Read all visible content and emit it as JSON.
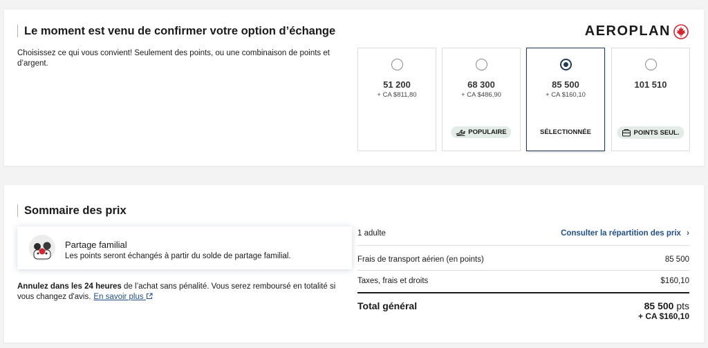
{
  "exchange": {
    "title": "Le moment est venu de confirmer votre option d’échange",
    "logo": "AEROPLAN",
    "intro": "Choisissez ce qui vous convient! Seulement des points, ou une combinaison de points et d’argent.",
    "options": [
      {
        "points": "51 200",
        "cash": "+ CA $811,80",
        "badge": "",
        "selected": false
      },
      {
        "points": "68 300",
        "cash": "+ CA $486,90",
        "badge": "POPULAIRE",
        "badge_icon": "plane-icon",
        "selected": false
      },
      {
        "points": "85 500",
        "cash": "+ CA $160,10",
        "badge": "SÉLECTIONNÉE",
        "selected": true
      },
      {
        "points": "101 510",
        "cash": "",
        "badge": "POINTS SEUL.",
        "badge_icon": "ticket-icon",
        "selected": false
      }
    ]
  },
  "summary": {
    "title": "Sommaire des prix",
    "family_title": "Partage familial",
    "family_text": "Les points seront échangés à partir du solde de partage familial.",
    "cancel_bold": "Annulez dans les 24 heures",
    "cancel_text": " de l’achat sans pénalité. Vous serez remboursé en totalité si vous changez d'avis.",
    "learn_more": "En savoir plus",
    "passengers": "1 adulte",
    "breakdown_link": "Consulter la répartition des prix",
    "fare_label": "Frais de transport aérien (en points)",
    "fare_value": "85 500",
    "taxes_label": "Taxes, frais et droits",
    "taxes_value": "$160,10",
    "total_label": "Total général",
    "total_points": "85 500",
    "total_points_unit": "pts",
    "total_cash": "+ CA $160,10"
  },
  "colors": {
    "accent": "#1f3a5a",
    "link": "#1f4e8c",
    "badge_bg": "#e3ece6",
    "brand_red": "#d22630"
  }
}
